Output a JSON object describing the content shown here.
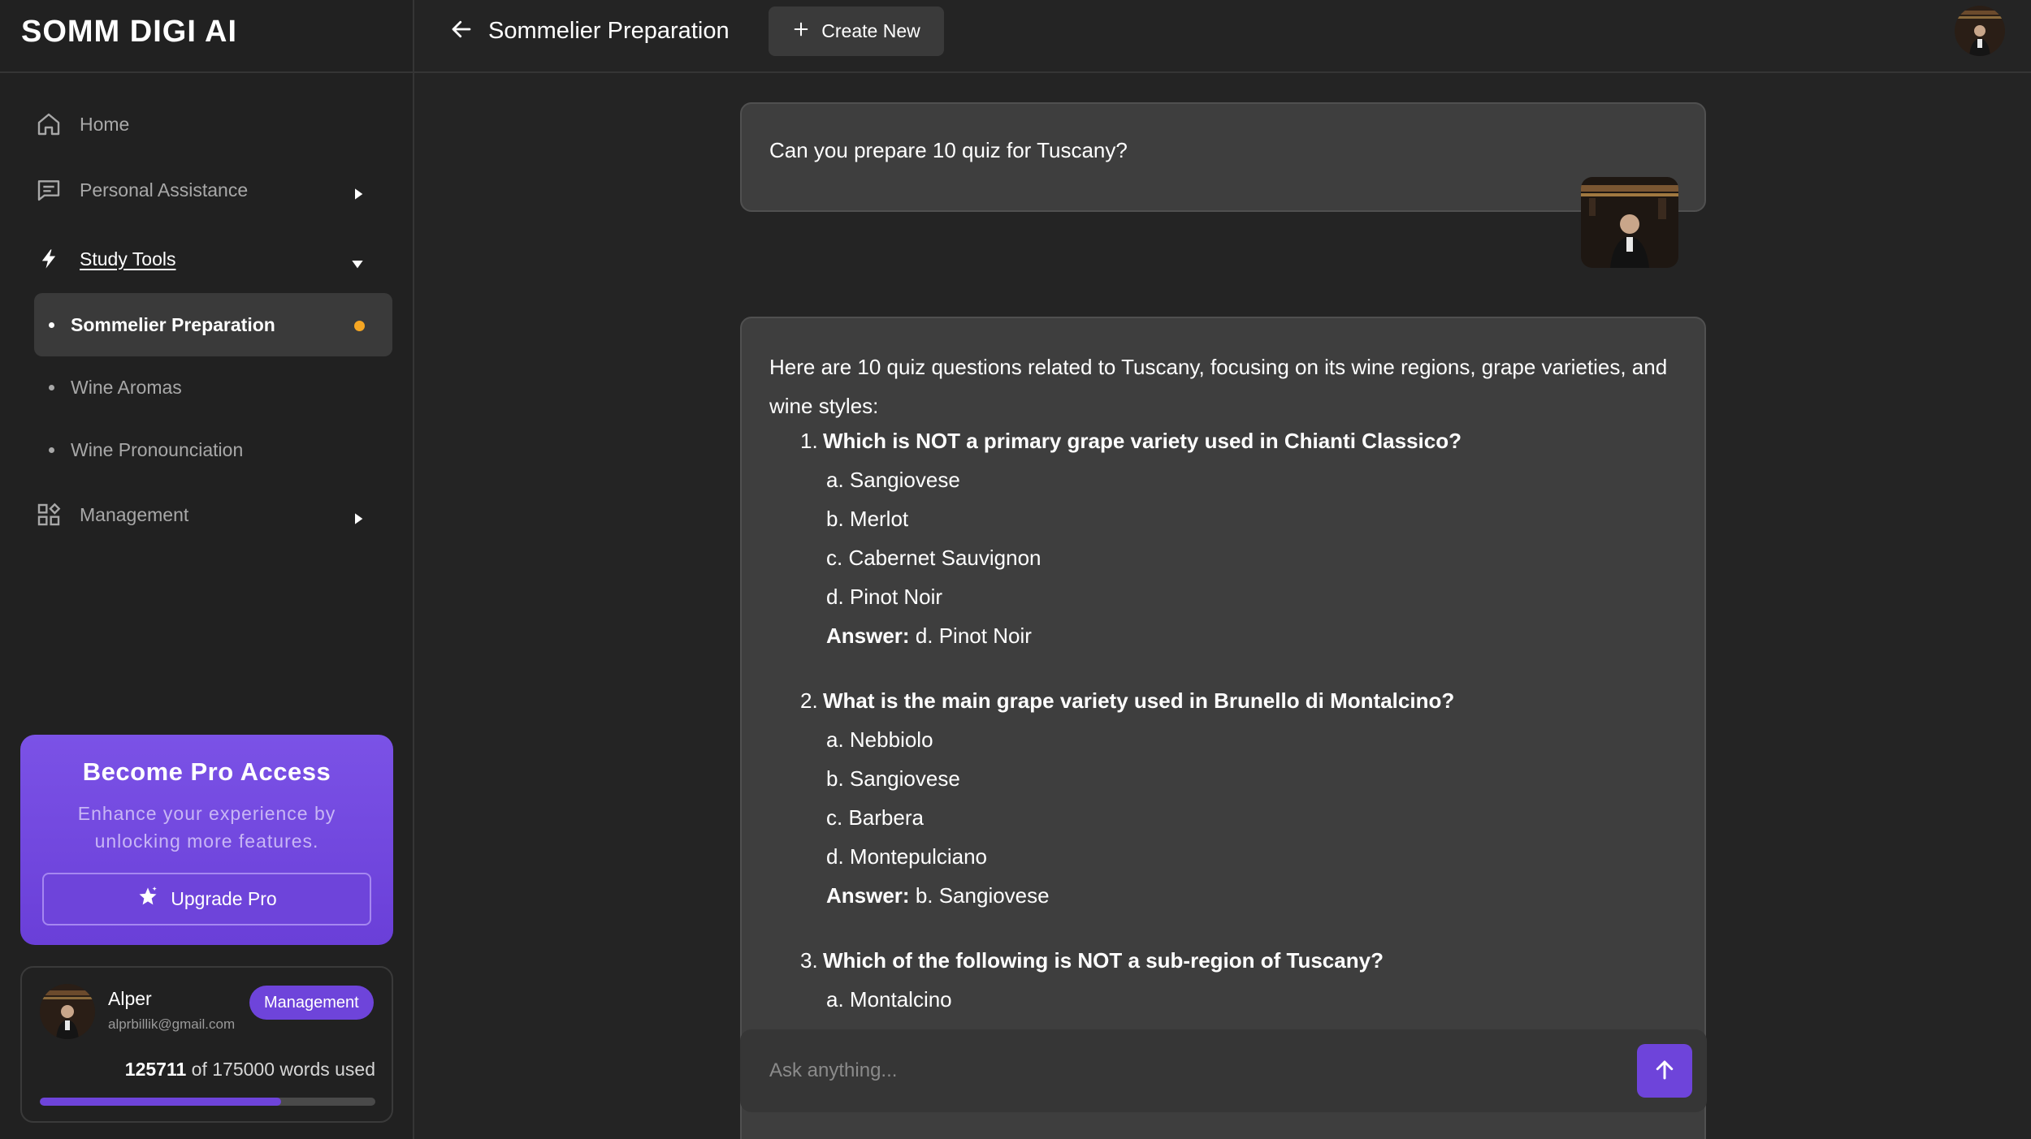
{
  "brand": "SOMM DIGI AI",
  "sidebar": {
    "home": "Home",
    "personal_assistance": "Personal Assistance",
    "study_tools": "Study Tools",
    "sub_items": [
      "Sommelier Preparation",
      "Wine Aromas",
      "Wine Pronounciation"
    ],
    "management": "Management",
    "active_indicator_color": "#f5a623"
  },
  "pro": {
    "title": "Become Pro Access",
    "description": "Enhance your experience by unlocking more features.",
    "button": "Upgrade Pro"
  },
  "user": {
    "name": "Alper",
    "email": "alprbillik@gmail.com",
    "role_badge": "Management",
    "words_used": "125711",
    "words_total_text": "of 175000 words used",
    "usage_fraction": 0.7184
  },
  "header": {
    "title": "Sommelier Preparation",
    "create_button": "Create New"
  },
  "chat": {
    "user_message": "Can you prepare 10 quiz for Tuscany?",
    "ai_intro": "Here are 10 quiz questions related to Tuscany, focusing on its wine regions, grape varieties, and wine styles:",
    "answer_label": "Answer:",
    "questions": [
      {
        "num": "1.",
        "title": "Which is NOT a primary grape variety used in Chianti Classico?",
        "options": [
          "a. Sangiovese",
          "b. Merlot",
          "c. Cabernet Sauvignon",
          "d. Pinot Noir"
        ],
        "answer": "d. Pinot Noir"
      },
      {
        "num": "2.",
        "title": "What is the main grape variety used in Brunello di Montalcino?",
        "options": [
          "a. Nebbiolo",
          "b. Sangiovese",
          "c. Barbera",
          "d. Montepulciano"
        ],
        "answer": "b. Sangiovese"
      },
      {
        "num": "3.",
        "title": "Which of the following is NOT a sub-region of Tuscany?",
        "options": [
          "a. Montalcino"
        ]
      }
    ]
  },
  "input": {
    "placeholder": "Ask anything..."
  },
  "colors": {
    "accent": "#6e44da",
    "background": "#242424",
    "sidebar": "#212121",
    "bubble": "#3e3e3e"
  }
}
